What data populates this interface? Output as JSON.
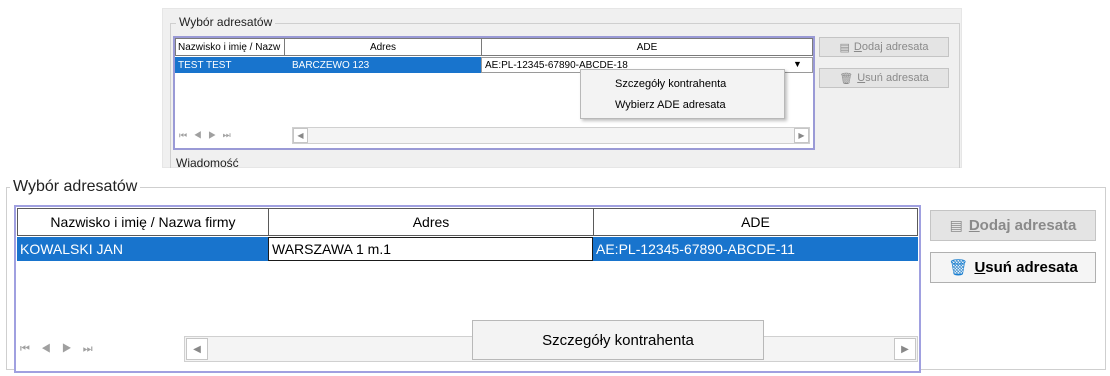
{
  "top": {
    "legend": "Wybór adresatów",
    "columns": [
      "Nazwisko i imię / Nazw",
      "Adres",
      "ADE"
    ],
    "row": [
      "TEST TEST",
      "BARCZEWO 123",
      "AE:PL-12345-67890-ABCDE-18"
    ],
    "context_menu": [
      "Szczegóły kontrahenta",
      "Wybierz ADE adresata"
    ],
    "add_hotkey": "D",
    "add_rest": "odaj adresata",
    "remove_hotkey": "U",
    "remove_rest": "suń adresata",
    "next_legend": "Wiadomość"
  },
  "bottom": {
    "legend": "Wybór adresatów",
    "columns": [
      "Nazwisko i imię / Nazwa firmy",
      "Adres",
      "ADE"
    ],
    "row": [
      "KOWALSKI JAN",
      "WARSZAWA 1 m.1",
      "AE:PL-12345-67890-ABCDE-11"
    ],
    "context_menu": [
      "Szczegóły kontrahenta"
    ],
    "add_hotkey": "D",
    "add_rest": "odaj adresata",
    "remove_hotkey": "U",
    "remove_rest": "suń adresata"
  },
  "nav_glyphs": "⏮ ◀ ▶ ⏭",
  "icons": {
    "add": "add-recipient-icon",
    "remove": "trash-icon",
    "dropdown": "dropdown-arrow-icon"
  },
  "colors": {
    "selection": "#1874cd",
    "grid_border": "#9a9ad6",
    "remove_icon": "#1a7fd0"
  }
}
